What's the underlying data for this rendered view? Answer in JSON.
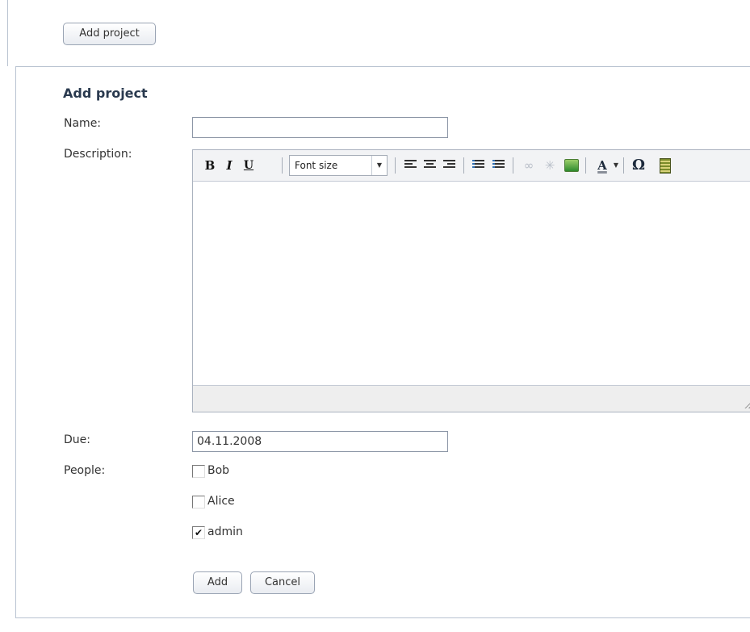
{
  "toolbar_top": {
    "add_project_label": "Add project"
  },
  "form": {
    "title": "Add project",
    "name_label": "Name:",
    "name_value": "",
    "description_label": "Description:",
    "due_label": "Due:",
    "due_value": "04.11.2008",
    "people_label": "People:",
    "people": [
      {
        "name": "Bob",
        "checked": false
      },
      {
        "name": "Alice",
        "checked": false
      },
      {
        "name": "admin",
        "checked": true
      }
    ],
    "add_label": "Add",
    "cancel_label": "Cancel"
  },
  "editor": {
    "font_size_placeholder": "Font size",
    "bold_glyph": "B",
    "italic_glyph": "I",
    "underline_glyph": "U",
    "font_color_glyph": "A",
    "special_char_glyph": "Ω",
    "check_glyph": "✔",
    "icons": [
      "bold-icon",
      "italic-icon",
      "underline-icon",
      "font-size-select",
      "align-left-icon",
      "align-center-icon",
      "align-right-icon",
      "bullet-list-icon",
      "numbered-list-icon",
      "link-icon",
      "unlink-icon",
      "image-icon",
      "font-color-icon",
      "special-char-icon",
      "media-icon"
    ]
  }
}
